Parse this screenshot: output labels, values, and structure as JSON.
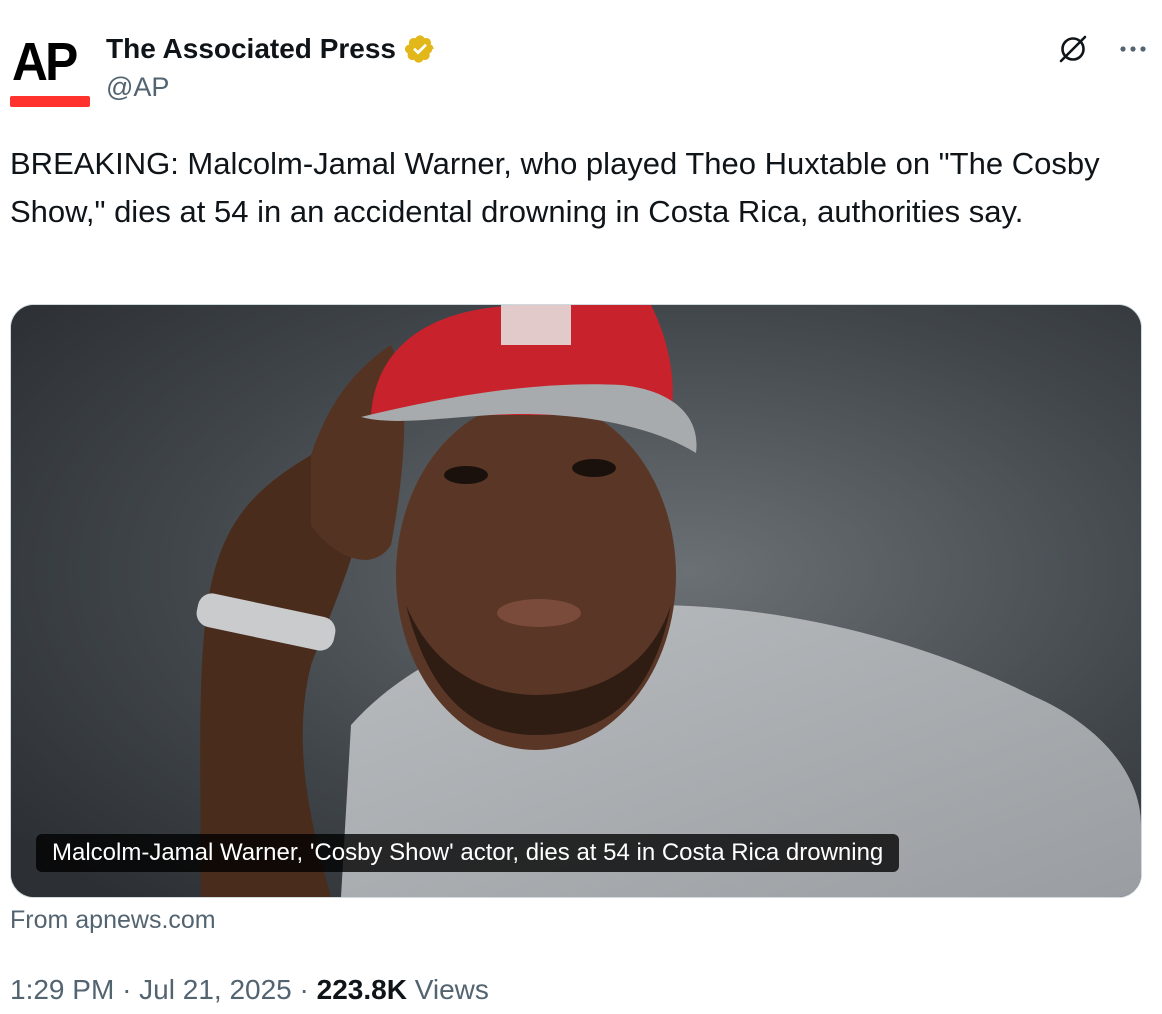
{
  "author": {
    "avatar_text": "AP",
    "name": "The Associated Press",
    "handle": "@AP",
    "verified_icon": "gold-verified-badge"
  },
  "actions": {
    "grok_icon": "grok-icon",
    "more_icon": "more-icon"
  },
  "tweet": {
    "text": "BREAKING: Malcolm-Jamal Warner, who played Theo Huxtable on \"The Cosby Show,\" dies at 54 in an accidental drowning in Costa Rica, authorities say."
  },
  "link_card": {
    "caption": "Malcolm-Jamal Warner, 'Cosby Show' actor, dies at 54 in Costa Rica drowning",
    "source": "From apnews.com"
  },
  "meta": {
    "time": "1:29 PM",
    "date": "Jul 21, 2025",
    "separator": "·",
    "views_count": "223.8K",
    "views_label": "Views"
  },
  "colors": {
    "ap_red": "#ff322e",
    "verified_gold": "#e2b719",
    "text_primary": "#0f1419",
    "text_secondary": "#536471",
    "border": "#cfd9de"
  }
}
